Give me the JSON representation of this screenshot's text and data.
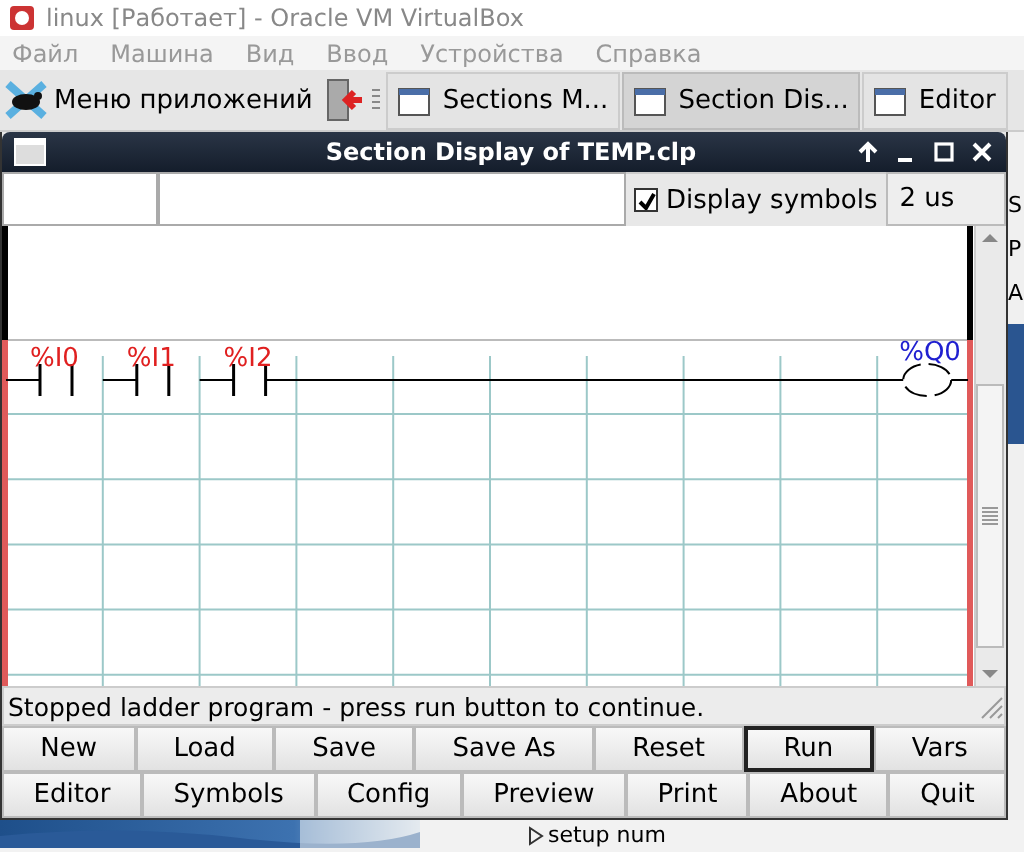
{
  "host_window": {
    "title": "linux [Работает] - Oracle VM VirtualBox"
  },
  "host_menu": [
    "Файл",
    "Машина",
    "Вид",
    "Ввод",
    "Устройства",
    "Справка"
  ],
  "taskbar": {
    "app_menu": "Меню приложений",
    "tasks": [
      {
        "label": "Sections M...",
        "selected": false
      },
      {
        "label": "Section Dis...",
        "selected": true
      },
      {
        "label": "Editor",
        "selected": false
      }
    ]
  },
  "window": {
    "title": "Section Display of TEMP.clp",
    "toolbar": {
      "display_symbols": {
        "label": "Display symbols",
        "checked": true
      },
      "period": "2 us"
    },
    "ladder": {
      "elements": [
        {
          "kind": "contact",
          "label": "%I0"
        },
        {
          "kind": "contact",
          "label": "%I1"
        },
        {
          "kind": "contact",
          "label": "%I2"
        },
        {
          "kind": "coil",
          "label": "%Q0"
        }
      ]
    },
    "status_bar": "Stopped ladder program - press run button to continue.",
    "button_rows": [
      [
        {
          "label": "New",
          "focused": false
        },
        {
          "label": "Load",
          "focused": false
        },
        {
          "label": "Save",
          "focused": false
        },
        {
          "label": "Save As",
          "focused": false
        },
        {
          "label": "Reset",
          "focused": false
        },
        {
          "label": "Run",
          "focused": true
        },
        {
          "label": "Vars",
          "focused": false
        }
      ],
      [
        {
          "label": "Editor",
          "focused": false
        },
        {
          "label": "Symbols",
          "focused": false
        },
        {
          "label": "Config",
          "focused": false
        },
        {
          "label": "Preview",
          "focused": false
        },
        {
          "label": "Print",
          "focused": false
        },
        {
          "label": "About",
          "focused": false
        },
        {
          "label": "Quit",
          "focused": false
        }
      ]
    ]
  },
  "background_window": {
    "labels": [
      "S",
      "P",
      "A"
    ]
  },
  "desktop": {
    "tree_item": "setup num"
  }
}
